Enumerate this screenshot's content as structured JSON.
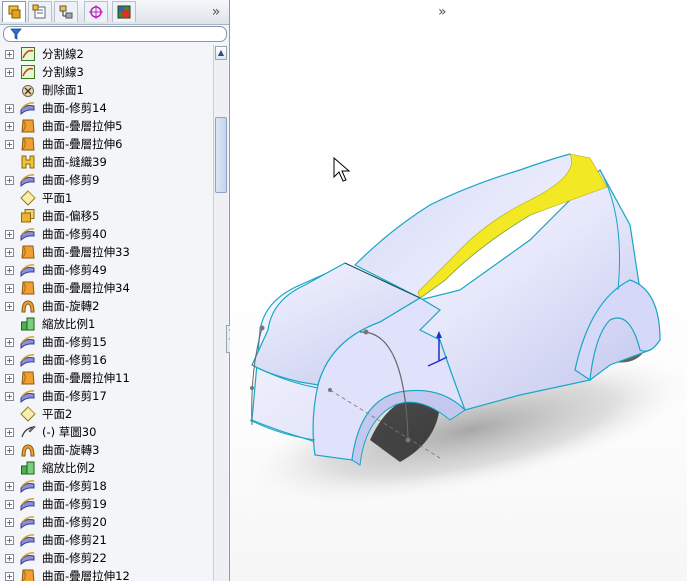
{
  "feature_tree": {
    "tabs": [
      {
        "name": "feature-manager-tab-icon",
        "active": true
      },
      {
        "name": "property-manager-tab-icon",
        "active": false
      },
      {
        "name": "configuration-manager-tab-icon",
        "active": false
      },
      {
        "name": "dimxpert-manager-tab-icon",
        "active": false
      },
      {
        "name": "display-manager-tab-icon",
        "active": false
      }
    ],
    "overflow_glyph": "»",
    "items": [
      {
        "label": "分割線2",
        "icon": "split-line-icon",
        "expandable": true
      },
      {
        "label": "分割線3",
        "icon": "split-line-icon",
        "expandable": true
      },
      {
        "label": "刪除面1",
        "icon": "delete-face-icon",
        "expandable": false
      },
      {
        "label": "曲面-修剪14",
        "icon": "trim-surface-icon",
        "expandable": true
      },
      {
        "label": "曲面-疊層拉伸5",
        "icon": "loft-surface-icon",
        "expandable": true
      },
      {
        "label": "曲面-疊層拉伸6",
        "icon": "loft-surface-icon",
        "expandable": true
      },
      {
        "label": "曲面-縫織39",
        "icon": "knit-surface-icon",
        "expandable": false
      },
      {
        "label": "曲面-修剪9",
        "icon": "trim-surface-icon",
        "expandable": true
      },
      {
        "label": "平面1",
        "icon": "plane-icon",
        "expandable": false
      },
      {
        "label": "曲面-偏移5",
        "icon": "offset-surface-icon",
        "expandable": false
      },
      {
        "label": "曲面-修剪40",
        "icon": "trim-surface-icon",
        "expandable": true
      },
      {
        "label": "曲面-疊層拉伸33",
        "icon": "loft-surface-icon",
        "expandable": true
      },
      {
        "label": "曲面-修剪49",
        "icon": "trim-surface-icon",
        "expandable": true
      },
      {
        "label": "曲面-疊層拉伸34",
        "icon": "loft-surface-icon",
        "expandable": true
      },
      {
        "label": "曲面-旋轉2",
        "icon": "revolve-surface-icon",
        "expandable": true
      },
      {
        "label": "縮放比例1",
        "icon": "scale-icon",
        "expandable": false
      },
      {
        "label": "曲面-修剪15",
        "icon": "trim-surface-icon",
        "expandable": true
      },
      {
        "label": "曲面-修剪16",
        "icon": "trim-surface-icon",
        "expandable": true
      },
      {
        "label": "曲面-疊層拉伸11",
        "icon": "loft-surface-icon",
        "expandable": true
      },
      {
        "label": "曲面-修剪17",
        "icon": "trim-surface-icon",
        "expandable": true
      },
      {
        "label": "平面2",
        "icon": "plane-icon",
        "expandable": false
      },
      {
        "label": "(-) 草圖30",
        "icon": "sketch-icon",
        "expandable": true
      },
      {
        "label": "曲面-旋轉3",
        "icon": "revolve-surface-icon",
        "expandable": true
      },
      {
        "label": "縮放比例2",
        "icon": "scale-icon",
        "expandable": false
      },
      {
        "label": "曲面-修剪18",
        "icon": "trim-surface-icon",
        "expandable": true
      },
      {
        "label": "曲面-修剪19",
        "icon": "trim-surface-icon",
        "expandable": true
      },
      {
        "label": "曲面-修剪20",
        "icon": "trim-surface-icon",
        "expandable": true
      },
      {
        "label": "曲面-修剪21",
        "icon": "trim-surface-icon",
        "expandable": true
      },
      {
        "label": "曲面-修剪22",
        "icon": "trim-surface-icon",
        "expandable": true
      },
      {
        "label": "曲面-疊層拉伸12",
        "icon": "loft-surface-icon",
        "expandable": true
      }
    ]
  },
  "viewport": {
    "model": "car-body-surface-model",
    "colors": {
      "body": "#e3e6fb",
      "edge": "#18a6c4",
      "highlight": "#f2e823",
      "shadow": "#b8b8b8"
    }
  }
}
